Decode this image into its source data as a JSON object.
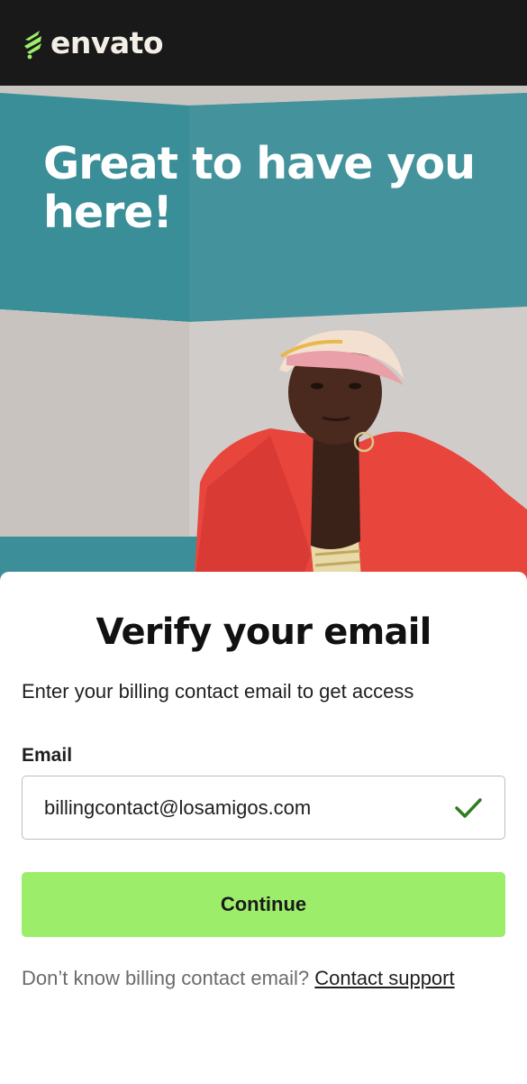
{
  "brand": {
    "name": "envato",
    "accent": "#9ced6a"
  },
  "hero": {
    "title": "Great to have you here!"
  },
  "verify": {
    "title": "Verify your email",
    "subtitle": "Enter your billing contact email to get access",
    "email_label": "Email",
    "email_value": "billingcontact@losamigos.com",
    "valid_icon": "check-icon",
    "continue_label": "Continue",
    "help_text": "Don’t know billing contact email?",
    "help_link": "Contact support"
  }
}
